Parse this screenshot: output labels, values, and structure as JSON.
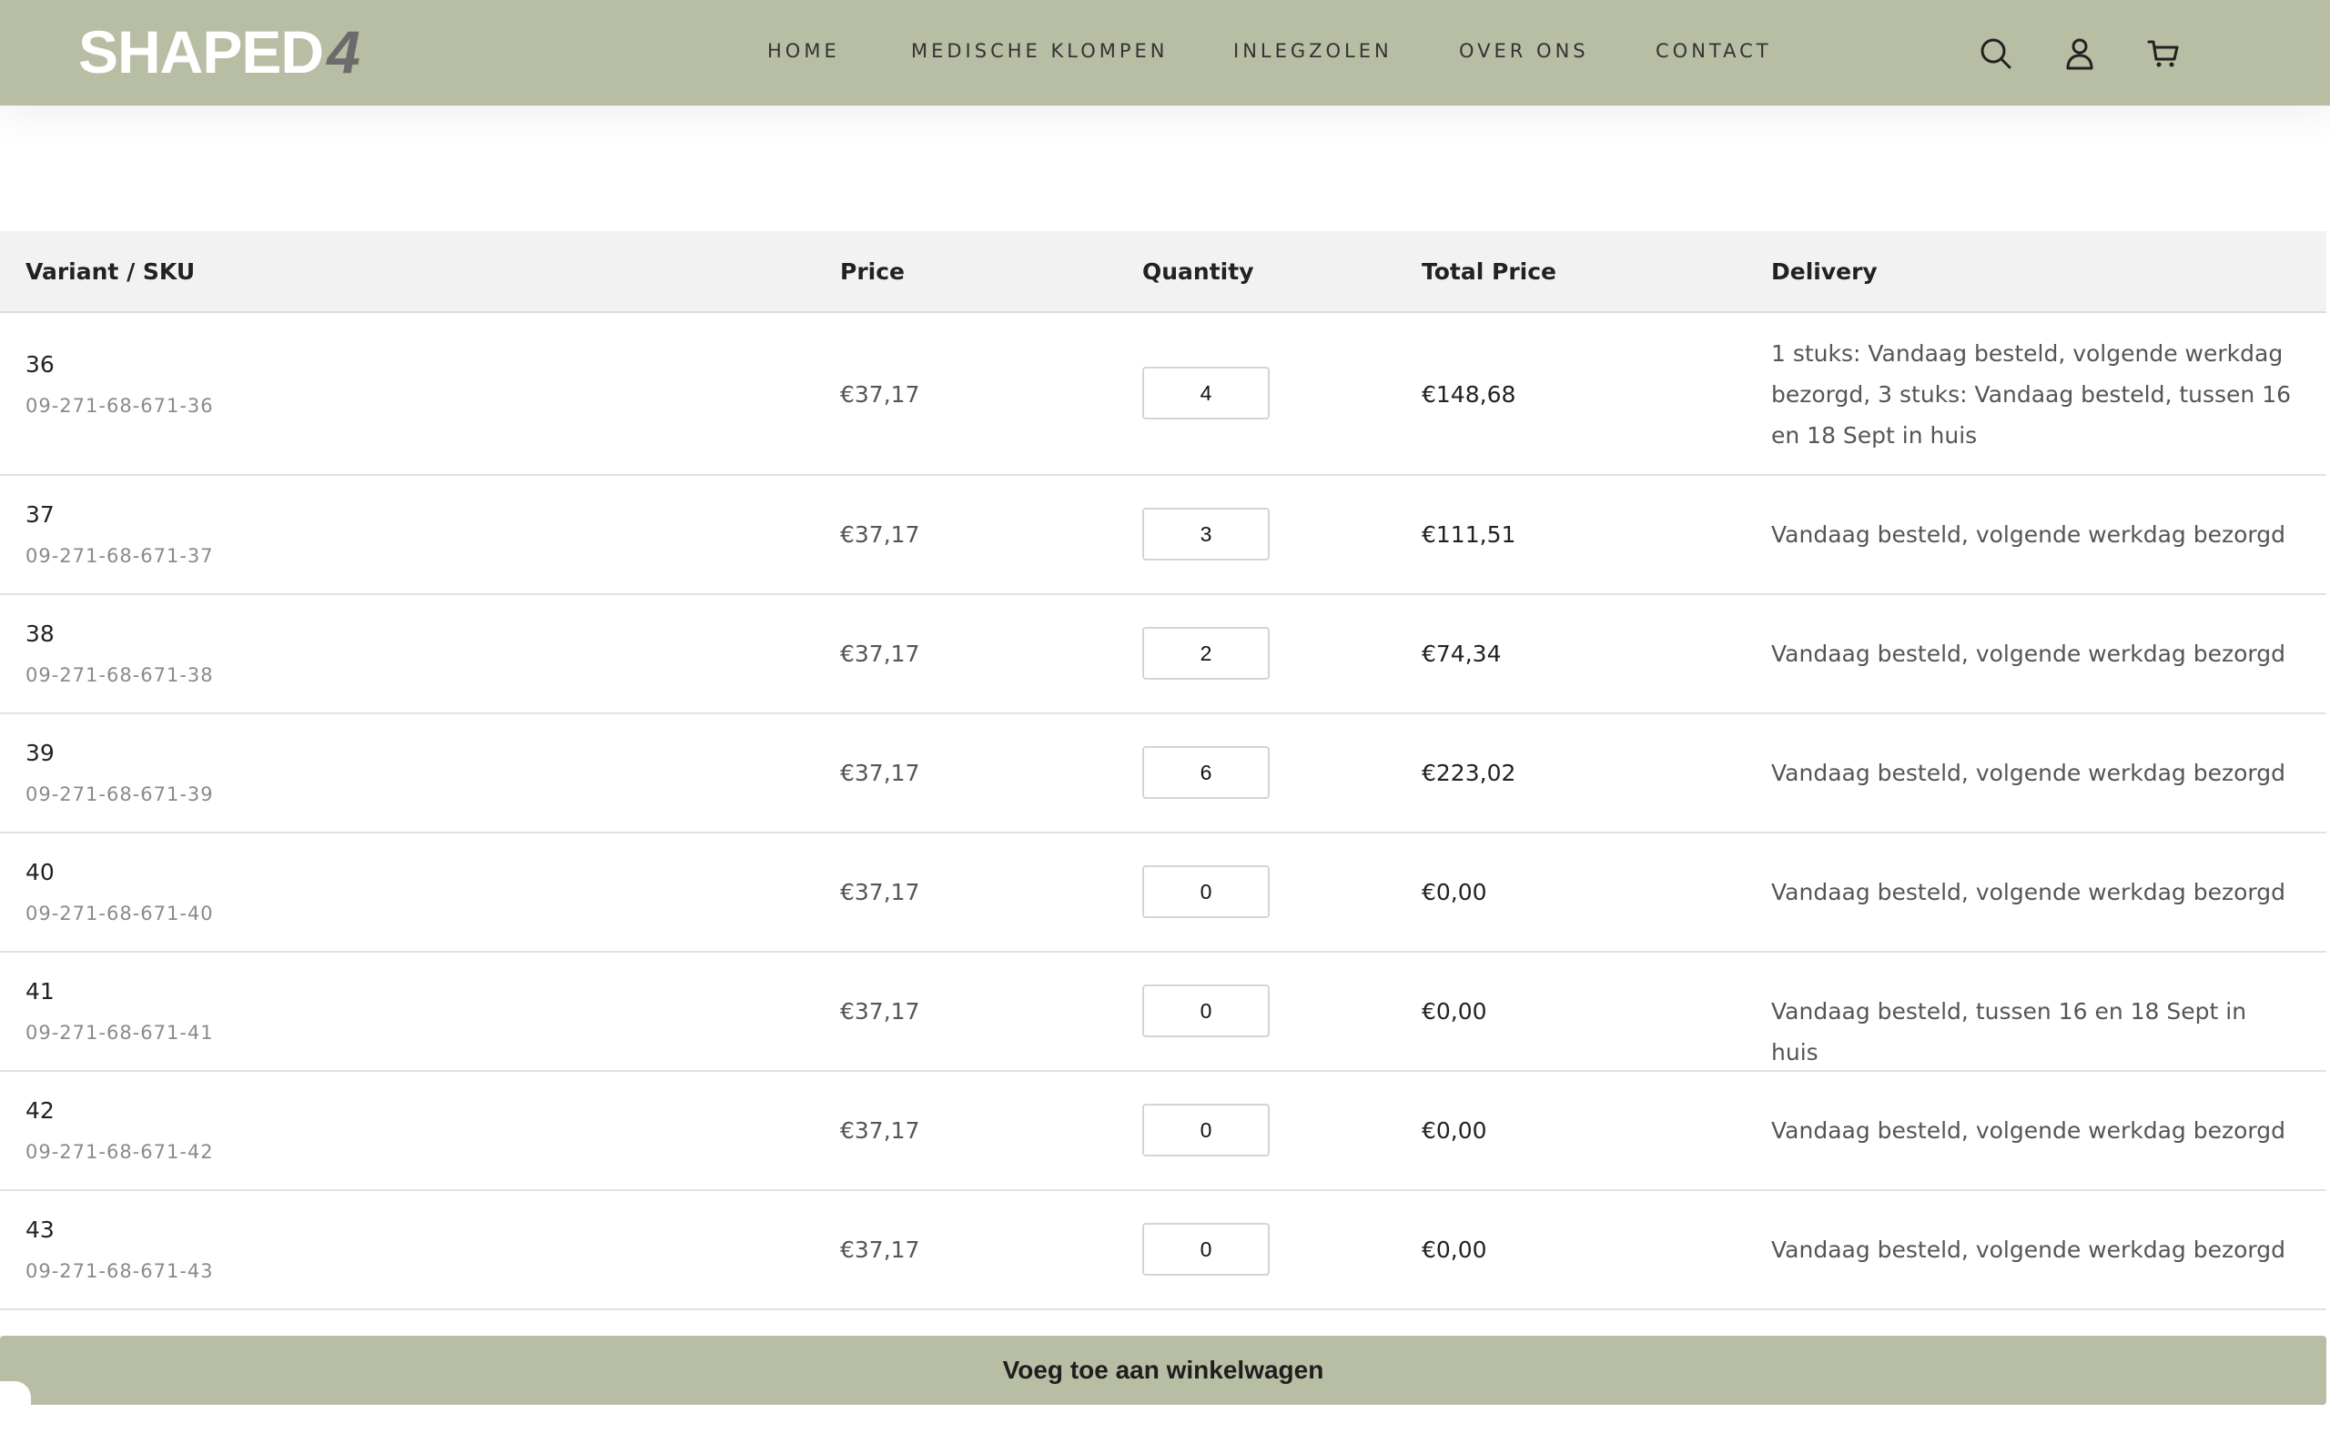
{
  "header": {
    "logo_text": "SHAPED",
    "logo_accent": "4",
    "nav": [
      {
        "label": "HOME"
      },
      {
        "label": "MEDISCHE KLOMPEN"
      },
      {
        "label": "INLEGZOLEN"
      },
      {
        "label": "OVER ONS"
      },
      {
        "label": "CONTACT"
      }
    ],
    "icons": [
      "search-icon",
      "account-icon",
      "cart-icon"
    ],
    "color": "#b7bea3"
  },
  "table": {
    "columns": [
      "Variant / SKU",
      "Price",
      "Quantity",
      "Total Price",
      "Delivery"
    ],
    "rows": [
      {
        "variant": "36",
        "sku": "09-271-68-671-36",
        "price": "€37,17",
        "qty": "4",
        "total": "€148,68",
        "delivery": "1 stuks: Vandaag besteld, volgende werkdag bezorgd, 3 stuks: Vandaag besteld, tussen 16 en 18 Sept in huis"
      },
      {
        "variant": "37",
        "sku": "09-271-68-671-37",
        "price": "€37,17",
        "qty": "3",
        "total": "€111,51",
        "delivery": "Vandaag besteld, volgende werkdag bezorgd"
      },
      {
        "variant": "38",
        "sku": "09-271-68-671-38",
        "price": "€37,17",
        "qty": "2",
        "total": "€74,34",
        "delivery": "Vandaag besteld, volgende werkdag bezorgd"
      },
      {
        "variant": "39",
        "sku": "09-271-68-671-39",
        "price": "€37,17",
        "qty": "6",
        "total": "€223,02",
        "delivery": "Vandaag besteld, volgende werkdag bezorgd"
      },
      {
        "variant": "40",
        "sku": "09-271-68-671-40",
        "price": "€37,17",
        "qty": "0",
        "total": "€0,00",
        "delivery": "Vandaag besteld, volgende werkdag bezorgd"
      },
      {
        "variant": "41",
        "sku": "09-271-68-671-41",
        "price": "€37,17",
        "qty": "0",
        "total": "€0,00",
        "delivery": "Vandaag besteld, tussen 16 en 18 Sept in huis"
      },
      {
        "variant": "42",
        "sku": "09-271-68-671-42",
        "price": "€37,17",
        "qty": "0",
        "total": "€0,00",
        "delivery": "Vandaag besteld, volgende werkdag bezorgd"
      },
      {
        "variant": "43",
        "sku": "09-271-68-671-43",
        "price": "€37,17",
        "qty": "0",
        "total": "€0,00",
        "delivery": "Vandaag besteld, volgende werkdag bezorgd"
      }
    ]
  },
  "cart_button": {
    "label": "Voeg toe aan winkelwagen"
  }
}
